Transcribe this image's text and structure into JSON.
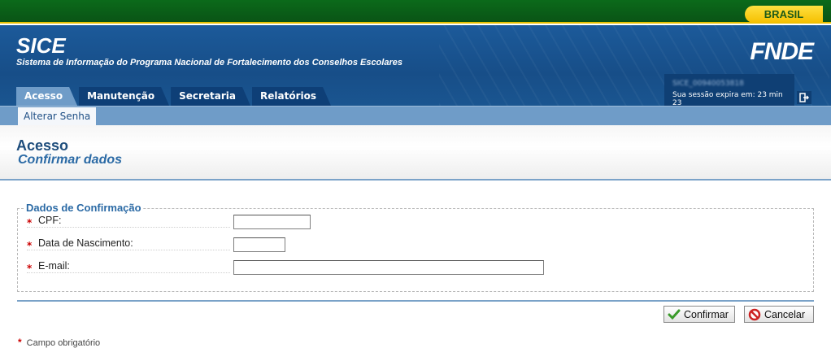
{
  "gov_bar": {
    "brand": "BRASIL"
  },
  "header": {
    "app_title": "SICE",
    "app_subtitle": "Sistema de Informação do Programa Nacional de Fortalecimento dos Conselhos Escolares",
    "org_logo": "FNDE",
    "tabs": [
      {
        "label": "Acesso",
        "active": true
      },
      {
        "label": "Manutenção",
        "active": false
      },
      {
        "label": "Secretaria",
        "active": false
      },
      {
        "label": "Relatórios",
        "active": false
      }
    ],
    "session": {
      "user": "SICE_00940053818",
      "expiry": "Sua sessão expira em: 23 min 23"
    }
  },
  "subnav": {
    "items": [
      {
        "label": "Alterar Senha"
      }
    ]
  },
  "page": {
    "title": "Acesso",
    "subtitle": "Confirmar dados"
  },
  "form": {
    "legend": "Dados de Confirmação",
    "required_marker": "*",
    "fields": [
      {
        "label": "CPF:",
        "value": ""
      },
      {
        "label": "Data de Nascimento:",
        "value": ""
      },
      {
        "label": "E-mail:",
        "value": ""
      }
    ]
  },
  "actions": {
    "confirm": {
      "label": "Confirmar",
      "icon": "check-icon"
    },
    "cancel": {
      "label": "Cancelar",
      "icon": "forbidden-icon"
    }
  },
  "footer_note": {
    "marker": "*",
    "text": "Campo obrigatório"
  },
  "colors": {
    "gov_green": "#0a5416",
    "brasil_yellow": "#f5c000",
    "header_blue": "#174e88",
    "tab_dark": "#0e3f77",
    "tab_active": "#6f9cc8",
    "title_blue": "#1e4d7c",
    "required_red": "#cc0000"
  }
}
